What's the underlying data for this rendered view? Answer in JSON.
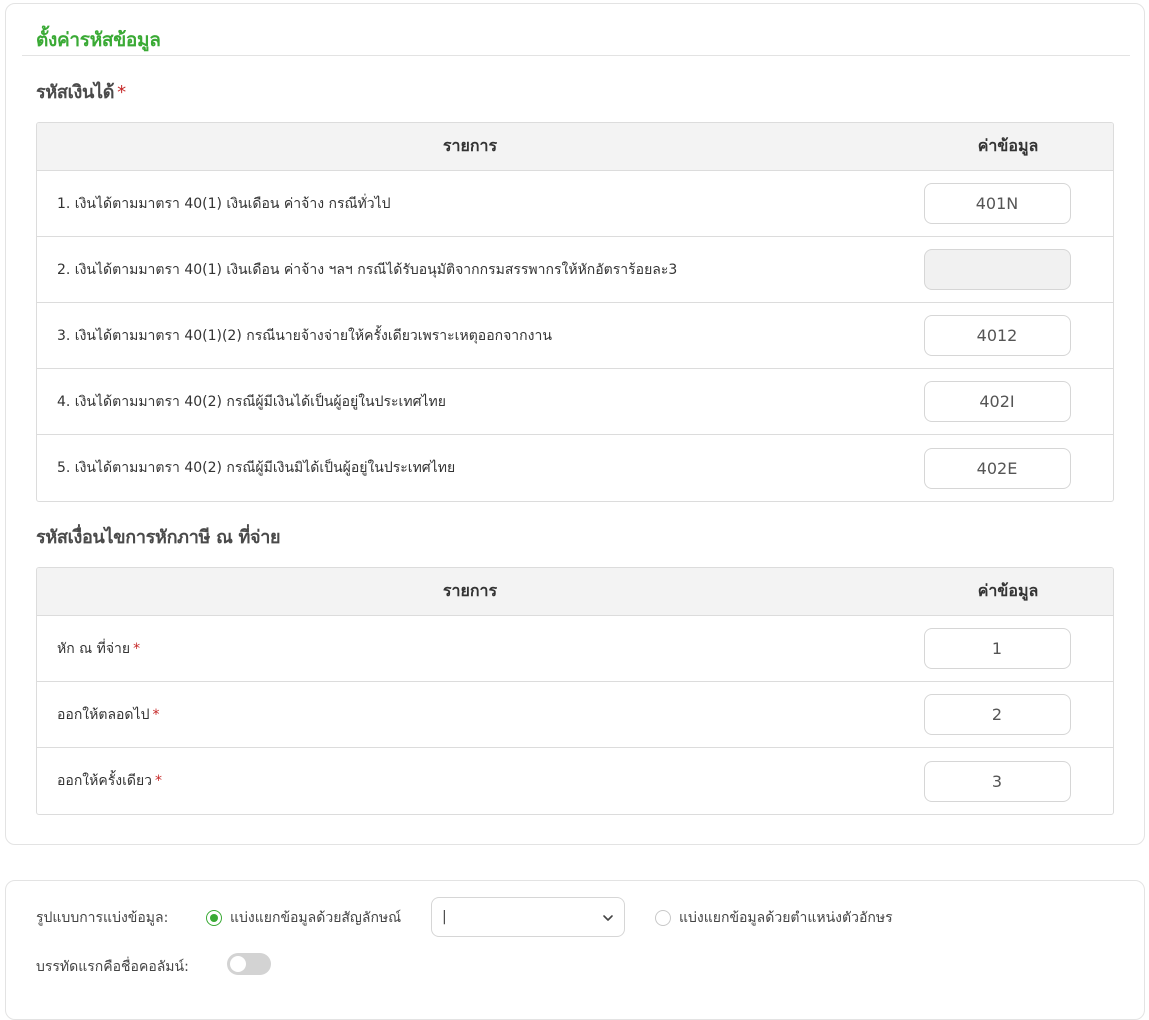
{
  "settings": {
    "title": "ตั้งค่ารหัสข้อมูล",
    "income_section": {
      "title": "รหัสเงินได้",
      "required_mark": "*",
      "table_header": {
        "item": "รายการ",
        "value": "ค่าข้อมูล"
      },
      "rows": [
        {
          "label": "1. เงินได้ตามมาตรา 40(1) เงินเดือน ค่าจ้าง กรณีทั่วไป",
          "value": "401N"
        },
        {
          "label": "2. เงินได้ตามมาตรา 40(1) เงินเดือน ค่าจ้าง ฯลฯ กรณีได้รับอนุมัติจากกรมสรรพากรให้หักอัตราร้อยละ3",
          "value": ""
        },
        {
          "label": "3. เงินได้ตามมาตรา 40(1)(2) กรณีนายจ้างจ่ายให้ครั้งเดียวเพราะเหตุออกจากงาน",
          "value": "4012"
        },
        {
          "label": "4. เงินได้ตามมาตรา 40(2) กรณีผู้มีเงินได้เป็นผู้อยู่ในประเทศไทย",
          "value": "402I"
        },
        {
          "label": "5. เงินได้ตามมาตรา 40(2) กรณีผู้มีเงินมิได้เป็นผู้อยู่ในประเทศไทย",
          "value": "402E"
        }
      ]
    },
    "withholding_section": {
      "title": "รหัสเงื่อนไขการหักภาษี ณ ที่จ่าย",
      "table_header": {
        "item": "รายการ",
        "value": "ค่าข้อมูล"
      },
      "rows": [
        {
          "label": "หัก ณ ที่จ่าย",
          "required_mark": "*",
          "value": "1"
        },
        {
          "label": "ออกให้ตลอดไป",
          "required_mark": "*",
          "value": "2"
        },
        {
          "label": "ออกให้ครั้งเดียว",
          "required_mark": "*",
          "value": "3"
        }
      ]
    }
  },
  "import_options": {
    "split_format_label": "รูปแบบการแบ่งข้อมูล:",
    "split_by_symbol_label": "แบ่งแยกข้อมูลด้วยสัญลักษณ์",
    "split_by_symbol_selected": true,
    "symbol_value": "|",
    "split_by_position_label": "แบ่งแยกข้อมูลด้วยตำแหน่งตัวอักษร",
    "split_by_position_selected": false,
    "first_row_header_label": "บรรทัดแรกคือชื่อคอลัมน์:",
    "first_row_header_on": false
  },
  "colors": {
    "accent": "#3aaa35",
    "required": "#c62828",
    "table_header_bg": "#f3f3f3"
  }
}
